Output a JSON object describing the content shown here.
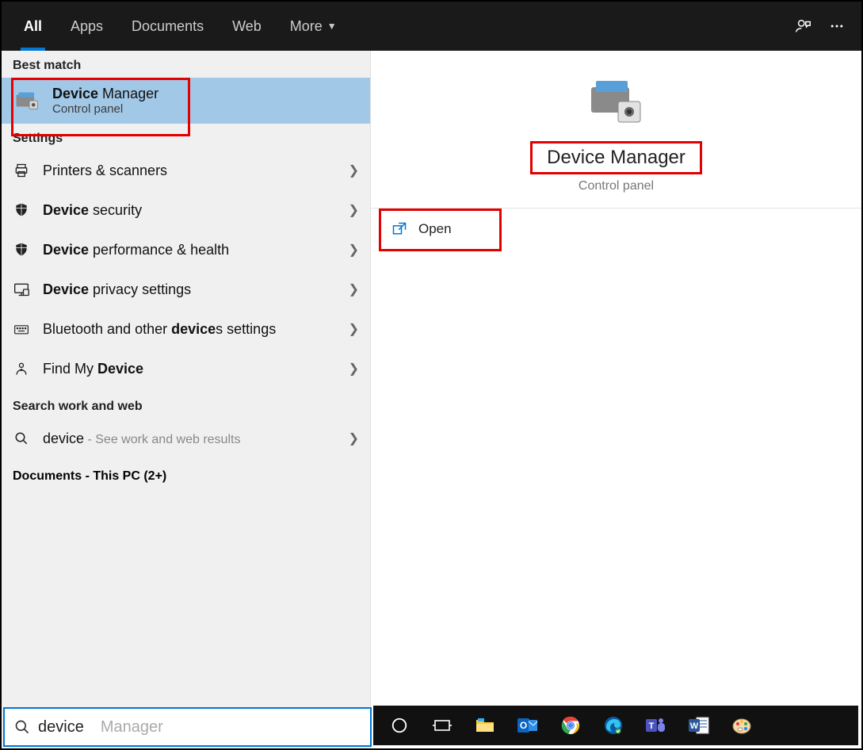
{
  "tabs": {
    "items": [
      "All",
      "Apps",
      "Documents",
      "Web",
      "More"
    ],
    "active": "All"
  },
  "left": {
    "best_match_header": "Best match",
    "best_match": {
      "title_bold": "Device",
      "title_rest": " Manager",
      "subtitle": "Control panel"
    },
    "settings_header": "Settings",
    "settings": [
      {
        "icon": "printer",
        "pre": "",
        "bold": "",
        "post": "Printers & scanners"
      },
      {
        "icon": "shield",
        "pre": "",
        "bold": "Device",
        "post": " security"
      },
      {
        "icon": "shield",
        "pre": "",
        "bold": "Device",
        "post": " performance & health"
      },
      {
        "icon": "monitor",
        "pre": "",
        "bold": "Device",
        "post": " privacy settings"
      },
      {
        "icon": "keyboard",
        "pre": "Bluetooth and other ",
        "bold": "device",
        "post": "s settings"
      },
      {
        "icon": "person",
        "pre": "Find My ",
        "bold": "Device",
        "post": ""
      }
    ],
    "search_work_web_header": "Search work and web",
    "search_row": {
      "term": "device",
      "hint": " - See work and web results"
    },
    "documents_header": "Documents - This PC (2+)"
  },
  "right": {
    "title": "Device Manager",
    "subtitle": "Control panel",
    "action": "Open"
  },
  "searchbar": {
    "typed": "device",
    "ghost": " Manager"
  },
  "taskbar_icons": [
    "cortana",
    "taskview",
    "explorer",
    "outlook",
    "chrome",
    "edge",
    "teams",
    "word",
    "paint"
  ]
}
